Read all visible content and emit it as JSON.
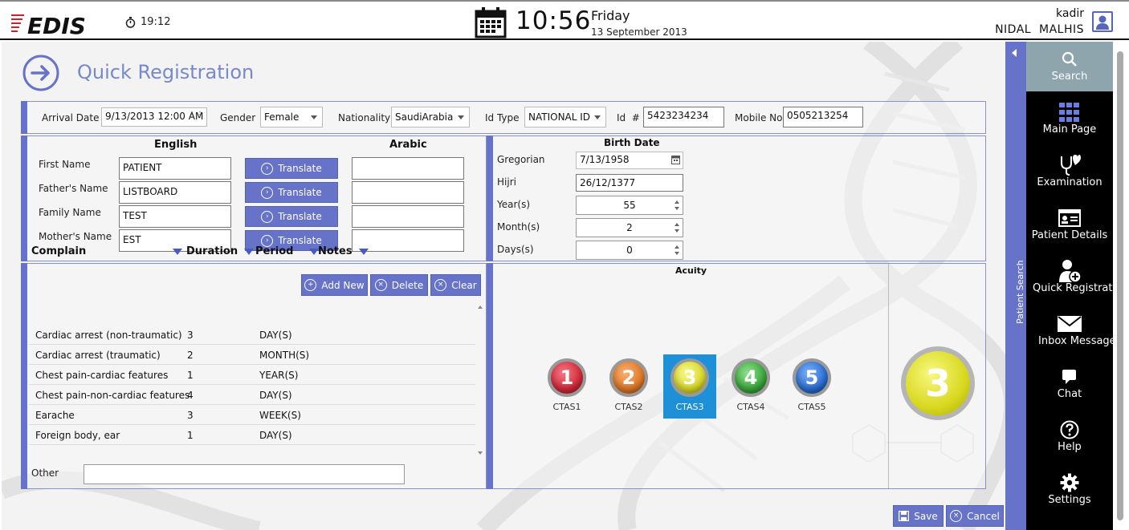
{
  "header": {
    "logo_text": "EDIS",
    "timer": "19:12",
    "clock": "10:56",
    "day": "Friday",
    "date": "13 September 2013",
    "username": "kadir",
    "full_name": "NIDAL  MALHIS"
  },
  "page": {
    "title": "Quick Registration"
  },
  "top_form": {
    "arrival_date_label": "Arrival Date",
    "arrival_date_value": "9/13/2013 12:00 AM",
    "gender_label": "Gender",
    "gender_value": "Female",
    "nationality_label": "Nationality",
    "nationality_value": "SaudiArabia",
    "id_type_label": "Id Type",
    "id_type_value": "NATIONAL ID",
    "id_label": "Id  #",
    "id_value": "5423234234",
    "mobile_label": "Mobile No",
    "mobile_value": "0505213254"
  },
  "names": {
    "english_header": "English",
    "arabic_header": "Arabic",
    "translate_label": "Translate",
    "rows": [
      {
        "label": "First Name",
        "value": "PATIENT"
      },
      {
        "label": "Father's Name",
        "value": "LISTBOARD"
      },
      {
        "label": "Family Name",
        "value": "TEST"
      },
      {
        "label": "Mother's Name",
        "value": "EST"
      }
    ]
  },
  "birth": {
    "header": "Birth Date",
    "gregorian_label": "Gregorian",
    "gregorian_value": "7/13/1958",
    "hijri_label": "Hijri",
    "hijri_value": "26/12/1377",
    "years_label": "Year(s)",
    "years_value": "55",
    "months_label": "Month(s)",
    "months_value": "2",
    "days_label": "Days(s)",
    "days_value": "0"
  },
  "complaints": {
    "add_new": "Add New",
    "delete": "Delete",
    "clear": "Clear",
    "columns": [
      "Complain",
      "Duration",
      "Period",
      "Notes"
    ],
    "rows": [
      {
        "complain": "Cardiac arrest (non-traumatic)",
        "duration": "3",
        "period": "DAY(S)"
      },
      {
        "complain": "Cardiac arrest (traumatic)",
        "duration": "2",
        "period": "MONTH(S)"
      },
      {
        "complain": "Chest pain-cardiac features",
        "duration": "1",
        "period": "YEAR(S)"
      },
      {
        "complain": "Chest pain-non-cardiac features",
        "duration": "4",
        "period": "DAY(S)"
      },
      {
        "complain": "Earache",
        "duration": "3",
        "period": "WEEK(S)"
      },
      {
        "complain": "Foreign body, ear",
        "duration": "1",
        "period": "DAY(S)"
      }
    ],
    "other_label": "Other",
    "other_value": ""
  },
  "acuity": {
    "header": "Acuity",
    "levels": [
      {
        "label": "CTAS1",
        "num": "1",
        "color": "#d42a3a"
      },
      {
        "label": "CTAS2",
        "num": "2",
        "color": "#e07a2a"
      },
      {
        "label": "CTAS3",
        "num": "3",
        "color": "#dada2a"
      },
      {
        "label": "CTAS4",
        "num": "4",
        "color": "#3aa83a"
      },
      {
        "label": "CTAS5",
        "num": "5",
        "color": "#2a6fd4"
      }
    ],
    "selected": "3"
  },
  "footer": {
    "save": "Save",
    "cancel": "Cancel"
  },
  "sidebar": {
    "collapse_label": "Patient Search",
    "items": [
      {
        "label": "Search",
        "icon": "search-icon"
      },
      {
        "label": "Main Page",
        "icon": "grid-icon"
      },
      {
        "label": "Examination",
        "icon": "stethoscope-icon"
      },
      {
        "label": "Patient Details",
        "icon": "id-card-icon"
      },
      {
        "label": "Quick Registration",
        "icon": "add-user-icon"
      },
      {
        "label": "Inbox Messages",
        "icon": "envelope-icon"
      },
      {
        "label": "Chat",
        "icon": "chat-icon"
      },
      {
        "label": "Help",
        "icon": "help-icon"
      },
      {
        "label": "Settings",
        "icon": "gear-icon"
      }
    ]
  },
  "colors": {
    "accent": "#6673c9",
    "selected_ctas": "#1e90d8",
    "sidebar_active": "#8fa5ad"
  }
}
